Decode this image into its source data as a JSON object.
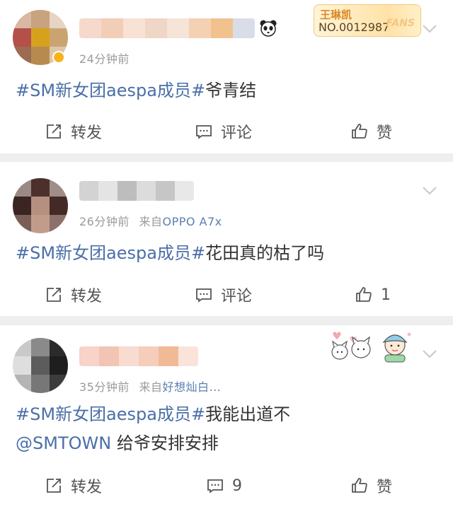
{
  "posts": [
    {
      "time": "24分钟前",
      "source_prefix": "",
      "source": "",
      "hashtag": "#SM新女团aespa成员#",
      "text": "爷青结",
      "mention": "",
      "text2": "",
      "repost_label": "转发",
      "comment_label": "评论",
      "like_label": "赞",
      "badge": {
        "name": "王琳凯",
        "number": "NO.0012987",
        "word": "FANS"
      }
    },
    {
      "time": "26分钟前",
      "source_prefix": "来自",
      "source": "OPPO A7x",
      "hashtag": "#SM新女团aespa成员#",
      "text": "花田真的枯了吗",
      "mention": "",
      "text2": "",
      "repost_label": "转发",
      "comment_label": "评论",
      "like_label": "1"
    },
    {
      "time": "35分钟前",
      "source_prefix": "来自",
      "source": "好想灿白...",
      "hashtag": "#SM新女团aespa成员#",
      "text": "我能出道不",
      "mention": "@SMTOWN",
      "text2": " 给爷安排安排",
      "repost_label": "转发",
      "comment_label": "9",
      "like_label": "赞"
    }
  ],
  "icons": {
    "repost": "repost-icon",
    "comment": "comment-icon",
    "like": "thumbs-up-icon",
    "more": "chevron-down-icon",
    "panda": "panda-icon"
  },
  "colors": {
    "link": "#4a6fa8",
    "meta": "#9a9a9a",
    "divider": "#eeeeee"
  }
}
